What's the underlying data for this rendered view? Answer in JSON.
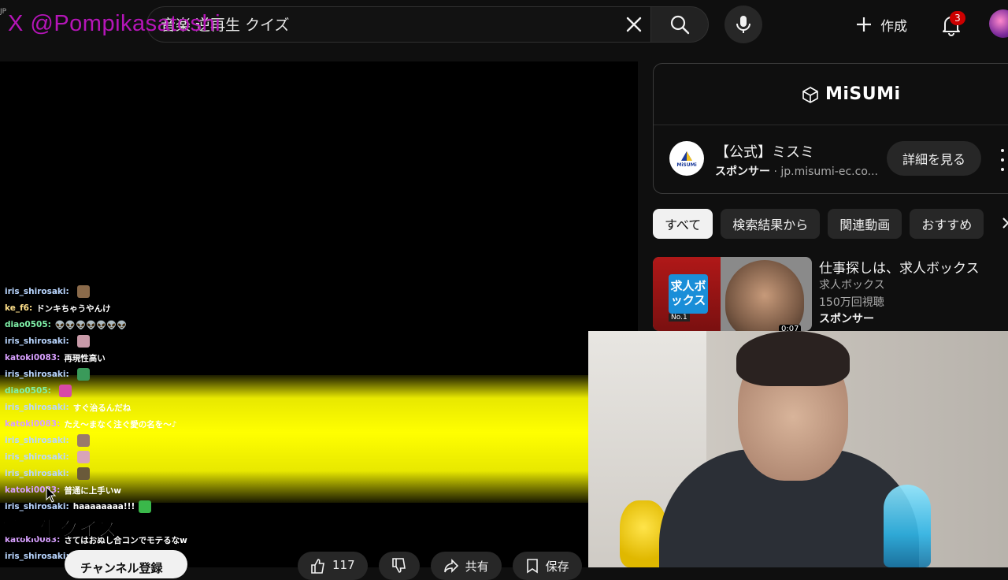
{
  "watermark": "X @Pompikasatoshi",
  "region_code": "JP",
  "search": {
    "query": "音楽 逆再生 クイズ"
  },
  "header": {
    "create_label": "作成",
    "notification_count": "3"
  },
  "chat": [
    {
      "user": "iris_shirosaki:",
      "msg": "",
      "cls": "u-iris",
      "emote": "#8a6a4a"
    },
    {
      "user": "ke_f6:",
      "msg": "ドンキちゃうやんけ",
      "cls": "u-ke",
      "emote": ""
    },
    {
      "user": "diao0505:",
      "msg": "👽👽👽👽👽👽👽",
      "cls": "u-diao",
      "emote": ""
    },
    {
      "user": "iris_shirosaki:",
      "msg": "",
      "cls": "u-iris",
      "emote": "#c89aa8"
    },
    {
      "user": "katoki0083:",
      "msg": "再現性高い",
      "cls": "u-katoki",
      "emote": ""
    },
    {
      "user": "iris_shirosaki:",
      "msg": "",
      "cls": "u-iris",
      "emote": "#3a9a5a"
    },
    {
      "user": "diao0505:",
      "msg": "",
      "cls": "u-diao",
      "emote": "#d84aa8"
    },
    {
      "user": "iris_shirosaki:",
      "msg": "すぐ治るんだね",
      "cls": "u-iris",
      "emote": ""
    },
    {
      "user": "katoki0083:",
      "msg": "たえ～まなく注ぐ愛の名を～♪",
      "cls": "u-katoki",
      "emote": ""
    },
    {
      "user": "iris_shirosaki:",
      "msg": "",
      "cls": "u-iris",
      "emote": "#9a7a6a"
    },
    {
      "user": "iris_shirosaki:",
      "msg": "",
      "cls": "u-iris",
      "emote": "#d8a4b8"
    },
    {
      "user": "iris_shirosaki:",
      "msg": "",
      "cls": "u-iris",
      "emote": "#6a5a3a"
    },
    {
      "user": "katoki0083:",
      "msg": "普通に上手いw",
      "cls": "u-katoki",
      "emote": ""
    },
    {
      "user": "iris_shirosaki:",
      "msg": "haaaaaaaa!!!",
      "cls": "u-iris",
      "emote": "#3ab84a"
    },
    {
      "user": "",
      "msg": "",
      "cls": "u-iris",
      "emote": ""
    },
    {
      "user": "katoki0083:",
      "msg": "さてはおぬし合コンでモテるなw",
      "cls": "u-katoki",
      "emote": ""
    },
    {
      "user": "iris_shirosaki:",
      "msg": "",
      "cls": "u-iris",
      "emote": ""
    }
  ],
  "video": {
    "overlay_title": "逆再生クイズ",
    "subscribe_label": "チャンネル登録",
    "like_count": "117",
    "share_label": "共有",
    "save_label": "保存"
  },
  "ad": {
    "brand_logo": "MiSUMi",
    "avatar_text": "MiSUMi",
    "title": "【公式】ミスミ",
    "sponsor_label": "スポンサー",
    "domain": "jp.misumi-ec.co...",
    "cta_label": "詳細を見る"
  },
  "chips": [
    "すべて",
    "検索結果から",
    "関連動画",
    "おすすめ"
  ],
  "recommended": {
    "badge": "求人ボックス",
    "badge_no1": "No.1",
    "title": "仕事探しは、求人ボックス",
    "channel": "求人ボックス",
    "views": "150万回視聴",
    "sponsor": "スポンサー",
    "duration": "0:07"
  },
  "colors": {
    "accent_red": "#cc0000",
    "watermark": "#b515b8",
    "yellow_band": "#ffff00"
  }
}
